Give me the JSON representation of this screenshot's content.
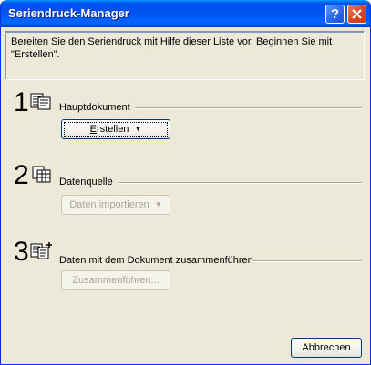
{
  "window": {
    "title": "Seriendruck-Manager",
    "help_glyph": "?",
    "accent_color": "#0053ee",
    "close_color": "#d9461f"
  },
  "info": {
    "text": "Bereiten Sie den Seriendruck mit Hilfe dieser Liste vor. Beginnen Sie mit \"Erstellen\"."
  },
  "steps": [
    {
      "number": "1",
      "label": "Hauptdokument",
      "icon": "main-document-icon",
      "button": {
        "first": "E",
        "rest": "rstellen",
        "caret": "▼",
        "enabled": true
      }
    },
    {
      "number": "2",
      "label": "Datenquelle",
      "icon": "data-source-icon",
      "button": {
        "text": "Daten importieren",
        "caret": "▼",
        "enabled": false
      }
    },
    {
      "number": "3",
      "label": "Daten mit dem Dokument zusammenführen",
      "icon": "merge-icon",
      "button": {
        "text": "Zusammenführen...",
        "enabled": false
      }
    }
  ],
  "footer": {
    "cancel": "Abbrechen"
  }
}
